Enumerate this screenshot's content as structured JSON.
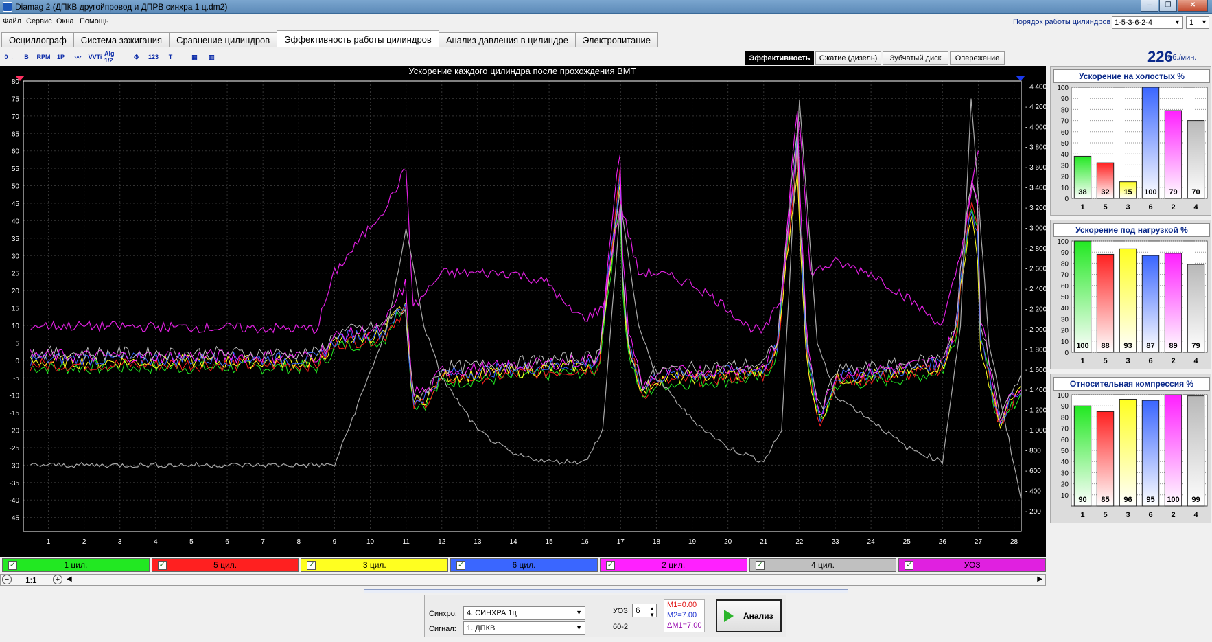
{
  "window": {
    "title": "Diamag 2 (ДПКВ другойпровод  и ДПРВ синхра 1 ц.dm2)",
    "buttons": [
      "–",
      "❐",
      "✕"
    ]
  },
  "menu": [
    "Файл",
    "Сервис",
    "Окна",
    "Помощь"
  ],
  "cylinder_order": {
    "label": "Порядок работы цилиндров",
    "value": "1-5-3-6-2-4",
    "spin_value": "1"
  },
  "tabs": [
    "Осциллограф",
    "Система зажигания",
    "Сравнение цилиндров",
    "Эффективность работы цилиндров",
    "Анализ давления в цилиндре",
    "Электропитание"
  ],
  "active_tab": 3,
  "toolbar_icons": [
    "marker-tool-icon",
    "bold-tool-icon",
    "zoom-rpm-icon",
    "cylinder-select-icon",
    "trace-icon",
    "vvti-icon",
    "alg-icon",
    "sync-icon",
    "scale-icon",
    "filter-icon",
    "compare-icon",
    "bars-icon"
  ],
  "toolbar_texts": [
    "0→",
    "B",
    "RPM",
    "1P",
    "〰",
    "VVTi",
    "Alg 1/2",
    "⚙",
    "123",
    "T",
    "▦",
    "▥"
  ],
  "subtabs": [
    "Эффективность",
    "Сжатие (дизель)",
    "Зубчатый диск",
    "Опережение"
  ],
  "active_subtab": 0,
  "rpm": {
    "value": "226",
    "unit": "об./мин."
  },
  "chart_data": {
    "type": "line",
    "title": "Ускорение каждого цилиндра после прохождения ВМТ",
    "x_ticks": [
      1,
      2,
      3,
      4,
      5,
      6,
      7,
      8,
      9,
      10,
      11,
      12,
      13,
      14,
      15,
      16,
      17,
      18,
      19,
      20,
      21,
      22,
      23,
      24,
      25,
      26,
      27,
      28
    ],
    "xlim": [
      0.3,
      28.2
    ],
    "ylim": [
      -49,
      80
    ],
    "y_ticks": [
      80,
      75,
      70,
      65,
      60,
      55,
      50,
      45,
      40,
      35,
      30,
      25,
      20,
      15,
      10,
      5,
      0,
      -5,
      -10,
      -15,
      -20,
      -25,
      -30,
      -35,
      -40,
      -45
    ],
    "y2lim": [
      -4,
      4450
    ],
    "y2_ticks": [
      4400,
      4200,
      4000,
      3800,
      3600,
      3400,
      3200,
      3000,
      2800,
      2600,
      2400,
      2200,
      2000,
      1800,
      1600,
      1400,
      1200,
      1000,
      800,
      600,
      400,
      200
    ],
    "grid": true,
    "series": [
      {
        "name": "1 цил.",
        "color": "#22e822",
        "peaks": [
          [
            11,
            18
          ],
          [
            17,
            48
          ],
          [
            22,
            72
          ],
          [
            27,
            70
          ]
        ]
      },
      {
        "name": "5 цил.",
        "color": "#ff2020",
        "peaks": [
          [
            11,
            15
          ],
          [
            17,
            55
          ],
          [
            22,
            65
          ],
          [
            27,
            68
          ]
        ]
      },
      {
        "name": "3 цил.",
        "color": "#ffff20",
        "peaks": [
          [
            11,
            16
          ],
          [
            17,
            50
          ],
          [
            22,
            60
          ],
          [
            27,
            60
          ]
        ]
      },
      {
        "name": "6 цил.",
        "color": "#3a66ff",
        "peaks": [
          [
            11,
            14
          ],
          [
            17,
            52
          ],
          [
            22,
            68
          ],
          [
            27,
            65
          ]
        ]
      },
      {
        "name": "2 цил.",
        "color": "#ff20ff",
        "peaks": [
          [
            11,
            20
          ],
          [
            17,
            60
          ],
          [
            22,
            78
          ],
          [
            27,
            75
          ]
        ]
      },
      {
        "name": "4 цил.",
        "color": "#c0c0c0",
        "peaks": [
          [
            11,
            12
          ],
          [
            17,
            45
          ],
          [
            22,
            70
          ],
          [
            27,
            72
          ]
        ]
      },
      {
        "name": "УОЗ",
        "color": "#e020e0",
        "values": [
          [
            0.5,
            10
          ],
          [
            8.5,
            9
          ],
          [
            9,
            25
          ],
          [
            10.5,
            45
          ],
          [
            11,
            55
          ],
          [
            11.2,
            15
          ],
          [
            12,
            25
          ],
          [
            13,
            25
          ],
          [
            14,
            25
          ],
          [
            15,
            22
          ],
          [
            15.5,
            15
          ],
          [
            16,
            12
          ],
          [
            16.5,
            15
          ],
          [
            17,
            45
          ],
          [
            17.5,
            25
          ],
          [
            18,
            25
          ],
          [
            19,
            22
          ],
          [
            20,
            15
          ],
          [
            20.5,
            10
          ],
          [
            21,
            8
          ],
          [
            21.5,
            18
          ],
          [
            22,
            70
          ],
          [
            22.3,
            25
          ],
          [
            23,
            28
          ],
          [
            24,
            25
          ],
          [
            25,
            18
          ],
          [
            26,
            10
          ],
          [
            26.5,
            30
          ],
          [
            27,
            60
          ]
        ]
      },
      {
        "name": "RPM",
        "color": "#a8a8a8",
        "values": [
          [
            0.5,
            -30
          ],
          [
            9,
            -30
          ],
          [
            10.5,
            10
          ],
          [
            11,
            38
          ],
          [
            11.5,
            10
          ],
          [
            12,
            -5
          ],
          [
            13,
            -20
          ],
          [
            14,
            -27
          ],
          [
            15,
            -29
          ],
          [
            16,
            -29
          ],
          [
            16.5,
            -20
          ],
          [
            17,
            45
          ],
          [
            17.5,
            10
          ],
          [
            18,
            -5
          ],
          [
            19,
            -17
          ],
          [
            20,
            -25
          ],
          [
            21,
            -29
          ],
          [
            21.5,
            -20
          ],
          [
            22,
            75
          ],
          [
            22.5,
            5
          ],
          [
            23,
            -10
          ],
          [
            24,
            -17
          ],
          [
            25,
            -25
          ],
          [
            26,
            -29
          ],
          [
            26.5,
            10
          ],
          [
            26.8,
            75
          ],
          [
            27.3,
            5
          ],
          [
            28.2,
            -40
          ]
        ]
      }
    ],
    "zero_line_y": -2.5
  },
  "legend": [
    {
      "label": "1 цил.",
      "color": "#22e822"
    },
    {
      "label": "5 цил.",
      "color": "#ff2020"
    },
    {
      "label": "3 цил.",
      "color": "#ffff20"
    },
    {
      "label": "6 цил.",
      "color": "#3a66ff"
    },
    {
      "label": "2 цил.",
      "color": "#ff20ff"
    },
    {
      "label": "4 цил.",
      "color": "#c0c0c0"
    },
    {
      "label": "УОЗ",
      "color": "#e020e0"
    }
  ],
  "zoom": {
    "value": "1:1",
    "minus": "−",
    "plus": "+",
    "left": "◀",
    "right": "▶"
  },
  "bar_charts": [
    {
      "title": "Ускорение на холостых %",
      "categories": [
        "1",
        "5",
        "3",
        "6",
        "2",
        "4"
      ],
      "values": [
        38,
        32,
        15,
        100,
        79,
        70
      ],
      "colors": [
        "#22e822",
        "#ff2020",
        "#ffff20",
        "#3a66ff",
        "#ff20ff",
        "#b8b8b8"
      ],
      "y_ticks": [
        100,
        90,
        80,
        70,
        60,
        50,
        40,
        30,
        20,
        10,
        0
      ],
      "ylim": [
        0,
        100
      ],
      "show_values": true
    },
    {
      "title": "Ускорение под нагрузкой %",
      "categories": [
        "1",
        "5",
        "3",
        "6",
        "2",
        "4"
      ],
      "values": [
        100,
        88,
        93,
        87,
        89,
        79
      ],
      "colors": [
        "#22e822",
        "#ff2020",
        "#ffff20",
        "#3a66ff",
        "#ff20ff",
        "#b8b8b8"
      ],
      "y_ticks": [
        100,
        90,
        80,
        70,
        60,
        50,
        40,
        30,
        20,
        10,
        0
      ],
      "ylim": [
        0,
        100
      ],
      "show_values": true
    },
    {
      "title": "Относительная компрессия %",
      "categories": [
        "1",
        "5",
        "3",
        "6",
        "2",
        "4"
      ],
      "values": [
        90,
        85,
        96,
        95,
        100,
        99
      ],
      "colors": [
        "#22e822",
        "#ff2020",
        "#ffff20",
        "#3a66ff",
        "#ff20ff",
        "#b8b8b8"
      ],
      "y_ticks": [
        100,
        90,
        80,
        70,
        60,
        50,
        40,
        30,
        20,
        10
      ],
      "ylim": [
        0,
        100
      ],
      "show_values": true
    }
  ],
  "bottom": {
    "sync_label": "Синхро:",
    "sync_value": "4.  СИНХРА 1ц",
    "signal_label": "Сигнал:",
    "signal_value": "1.  ДПКВ",
    "uoz_label": "УОЗ",
    "uoz_value": "6",
    "teeth": "60-2",
    "m1": "M1=0.00",
    "m2": "M2=7.00",
    "dm1": "ΔM1=7.00",
    "analyze": "Анализ"
  }
}
